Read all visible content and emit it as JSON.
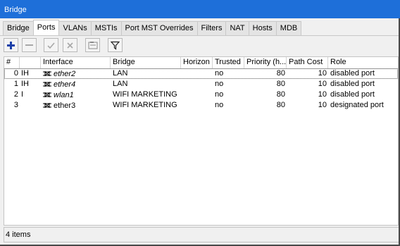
{
  "window": {
    "title": "Bridge"
  },
  "tabs": [
    "Bridge",
    "Ports",
    "VLANs",
    "MSTIs",
    "Port MST Overrides",
    "Filters",
    "NAT",
    "Hosts",
    "MDB"
  ],
  "active_tab": "Ports",
  "toolbar": {
    "add": "plus-icon",
    "remove": "minus-icon",
    "enable": "check-icon",
    "disable": "x-icon",
    "comment": "comment-icon",
    "filter": "filter-icon"
  },
  "table": {
    "columns": [
      "#",
      "",
      "Interface",
      "Bridge",
      "Horizon",
      "Trusted",
      "Priority (h...",
      "Path Cost",
      "Role"
    ],
    "rows": [
      {
        "num": "0",
        "flags": "IH",
        "interface": "ether2",
        "bridge": "LAN",
        "horizon": "",
        "trusted": "no",
        "priority": "80",
        "path_cost": "10",
        "role": "disabled port"
      },
      {
        "num": "1",
        "flags": "IH",
        "interface": "ether4",
        "bridge": "LAN",
        "horizon": "",
        "trusted": "no",
        "priority": "80",
        "path_cost": "10",
        "role": "disabled port"
      },
      {
        "num": "2",
        "flags": "I",
        "interface": "wlan1",
        "bridge": "WIFI MARKETING",
        "horizon": "",
        "trusted": "no",
        "priority": "80",
        "path_cost": "10",
        "role": "disabled port"
      },
      {
        "num": "3",
        "flags": "",
        "interface": "ether3",
        "bridge": "WIFI MARKETING",
        "horizon": "",
        "trusted": "no",
        "priority": "80",
        "path_cost": "10",
        "role": "designated port"
      }
    ]
  },
  "status": {
    "items_count": "4 items"
  },
  "colors": {
    "titlebar": "#1e6fd9",
    "add_icon": "#1a3fa8"
  }
}
